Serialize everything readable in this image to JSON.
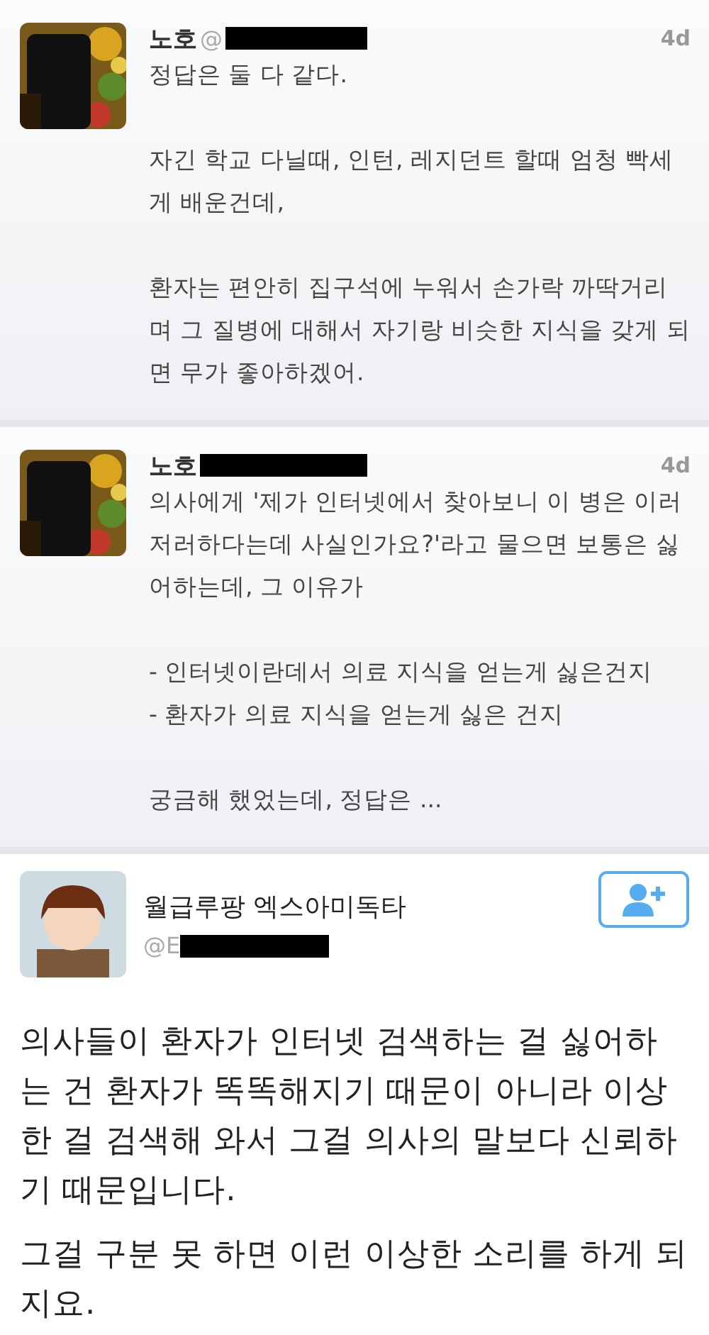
{
  "replies": [
    {
      "name": "노호",
      "handle": "@",
      "time": "4d",
      "paragraphs": [
        [
          "정답은 둘 다 같다."
        ],
        [
          "자긴 학교 다닐때, 인턴, 레지던트 할때 엄청 빡세게 배운건데,"
        ],
        [
          "환자는 편안히 집구석에 누워서 손가락 까딱거리며 그 질병에 대해서 자기랑 비슷한 지식을 갖게 되면 무가 좋아하겠어."
        ]
      ]
    },
    {
      "name": "노호",
      "time": "4d",
      "paragraphs": [
        [
          "의사에게 '제가 인터넷에서 찾아보니 이 병은 이러 저러하다는데 사실인가요?'라고 물으면 보통은 싫어하는데, 그 이유가"
        ],
        [
          "- 인터넷이란데서 의료 지식을 얻는게 싫은건지",
          "- 환자가 의료 지식을 얻는게 싫은 건지"
        ],
        [
          "궁금해 했었는데, 정답은 ..."
        ]
      ]
    }
  ],
  "main_tweet": {
    "name": "월급루팡 엑스아미독타",
    "handle": "@E",
    "paragraphs": [
      "의사들이 환자가 인터넷 검색하는 걸 싫어하는 건 환자가 똑똑해지기 때문이 아니라 이상한 걸 검색해 와서 그걸 의사의 말보다 신뢰하기 때문입니다.",
      "그걸 구분 못 하면 이런 이상한 소리를 하게 되지요."
    ]
  }
}
